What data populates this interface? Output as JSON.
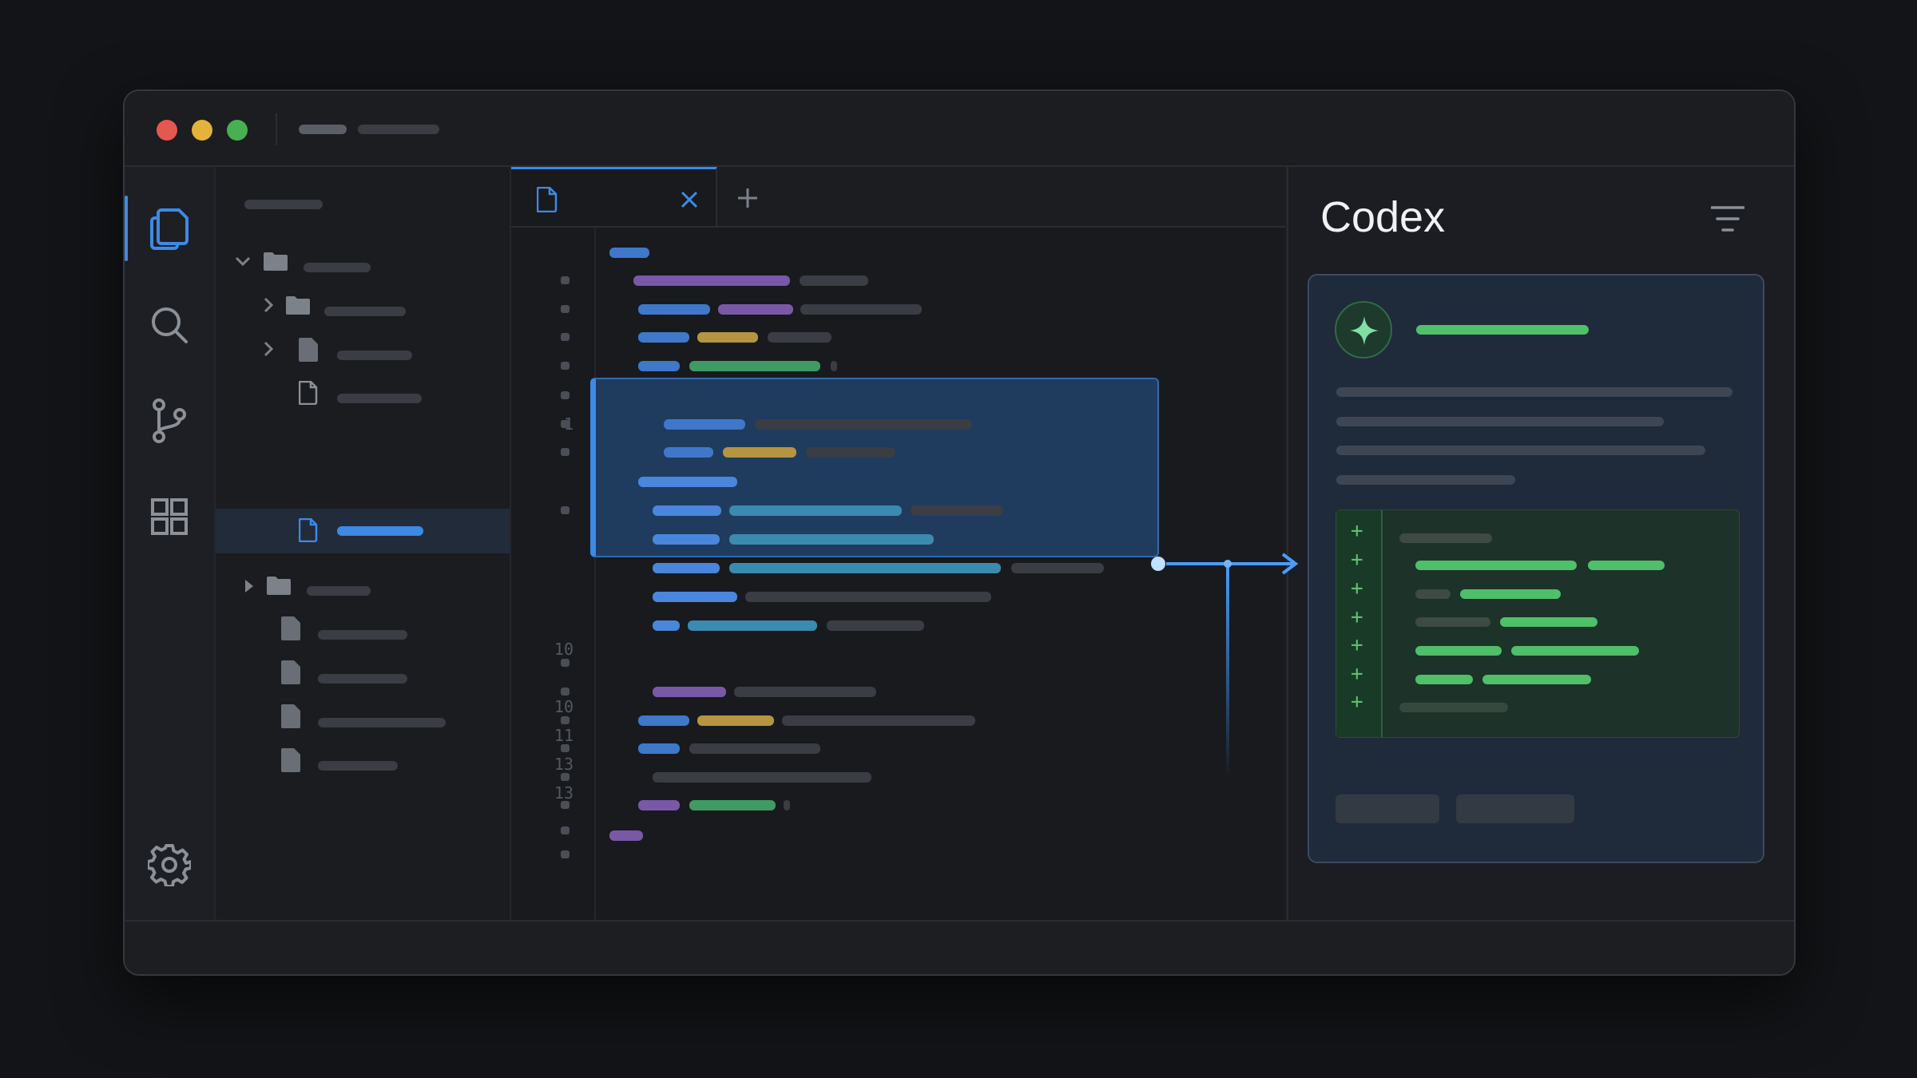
{
  "app": {
    "colors": {
      "accent": "#3d8ae6",
      "close_red": "#e4584f",
      "minimize_yellow": "#e3b33a",
      "maximize_green": "#48b052",
      "diff_green": "#5ac26a"
    }
  },
  "activity_bar": {
    "items": [
      {
        "icon": "files-icon",
        "active": true
      },
      {
        "icon": "search-icon"
      },
      {
        "icon": "source-control-icon"
      },
      {
        "icon": "extensions-icon"
      }
    ],
    "bottom_icon": "gear-icon"
  },
  "editor": {
    "tab_icon": "file-icon",
    "close_icon": "close-icon",
    "new_tab_icon": "plus-icon",
    "line_numbers": [
      "1",
      "10",
      "10",
      "11",
      "13",
      "13"
    ]
  },
  "codex": {
    "title": "Codex",
    "filter_icon": "filter-icon",
    "assistant_icon": "sparkle-icon",
    "diff_marker": "+"
  }
}
